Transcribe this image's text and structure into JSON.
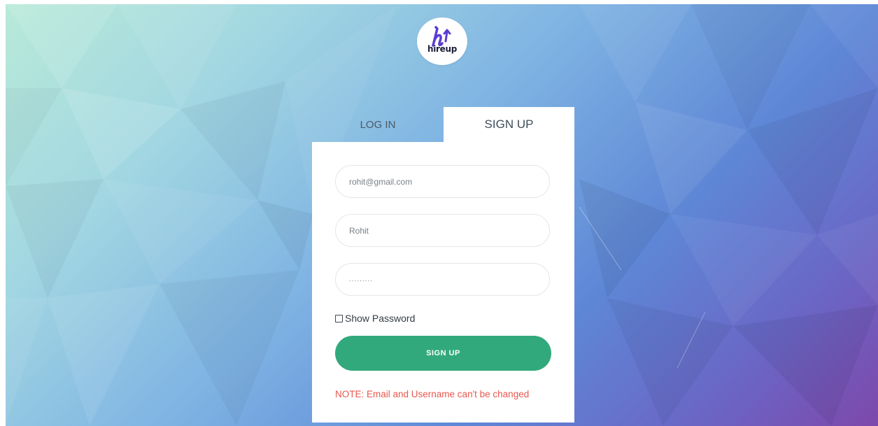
{
  "brand": {
    "logo_word": "hireup",
    "logo_mark": "h-arrow-icon"
  },
  "tabs": [
    {
      "label": "LOG IN",
      "active": false
    },
    {
      "label": "SIGN UP",
      "active": true
    }
  ],
  "form": {
    "email": {
      "value": "rohit@gmail.com"
    },
    "username": {
      "value": "Rohit"
    },
    "password": {
      "value": "........."
    },
    "show_password_label": "Show Password",
    "show_password_checked": false,
    "submit_label": "SIGN UP",
    "note": "NOTE: Email and Username can't be changed"
  },
  "colors": {
    "accent": "#32a97c",
    "note": "#e8574f",
    "logo_mark": "#5b3cd1"
  }
}
